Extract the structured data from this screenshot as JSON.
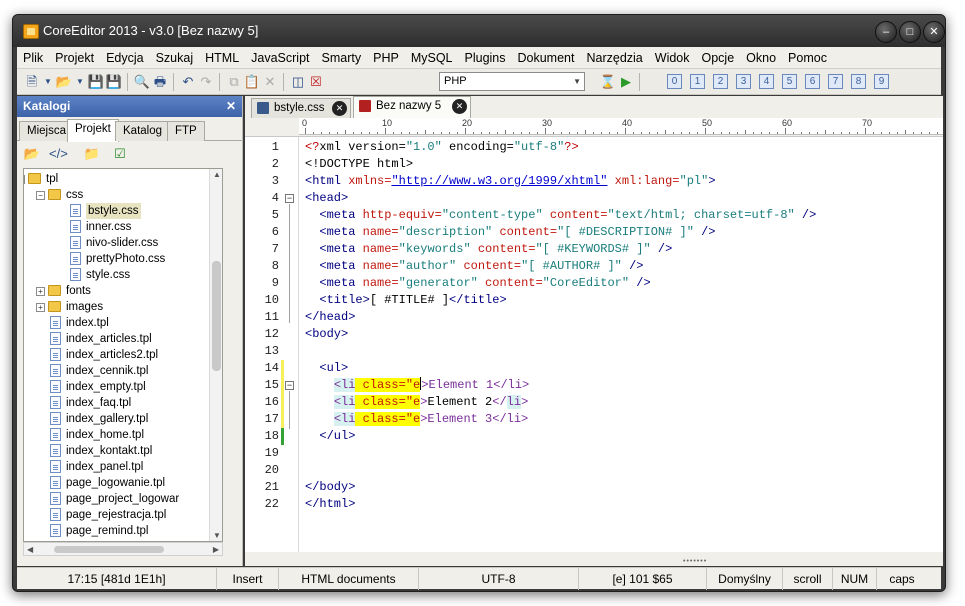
{
  "window": {
    "title": "CoreEditor 2013 - v3.0 [Bez nazwy 5]"
  },
  "menu": [
    "Plik",
    "Projekt",
    "Edycja",
    "Szukaj",
    "HTML",
    "JavaScript",
    "Smarty",
    "PHP",
    "MySQL",
    "Plugins",
    "Dokument",
    "Narzędzia",
    "Widok",
    "Opcje",
    "Okno",
    "Pomoc"
  ],
  "toolbar": {
    "language": "PHP",
    "bookmarks": [
      "0",
      "1",
      "2",
      "3",
      "4",
      "5",
      "6",
      "7",
      "8",
      "9"
    ]
  },
  "sidebar": {
    "title": "Katalogi",
    "tabs": [
      "Miejsca",
      "Projekt",
      "Katalog",
      "FTP"
    ],
    "active_tab": "Projekt",
    "tree": [
      {
        "label": "tpl",
        "type": "folder",
        "level": 0,
        "expanded": true
      },
      {
        "label": "css",
        "type": "folder",
        "level": 1,
        "expanded": true
      },
      {
        "label": "bstyle.css",
        "type": "file",
        "level": 2,
        "selected": true
      },
      {
        "label": "inner.css",
        "type": "file",
        "level": 2
      },
      {
        "label": "nivo-slider.css",
        "type": "file",
        "level": 2
      },
      {
        "label": "prettyPhoto.css",
        "type": "file",
        "level": 2
      },
      {
        "label": "style.css",
        "type": "file",
        "level": 2
      },
      {
        "label": "fonts",
        "type": "folder",
        "level": 1,
        "expanded": false
      },
      {
        "label": "images",
        "type": "folder",
        "level": 1,
        "expanded": false
      },
      {
        "label": "index.tpl",
        "type": "file",
        "level": 1
      },
      {
        "label": "index_articles.tpl",
        "type": "file",
        "level": 1
      },
      {
        "label": "index_articles2.tpl",
        "type": "file",
        "level": 1
      },
      {
        "label": "index_cennik.tpl",
        "type": "file",
        "level": 1
      },
      {
        "label": "index_empty.tpl",
        "type": "file",
        "level": 1
      },
      {
        "label": "index_faq.tpl",
        "type": "file",
        "level": 1
      },
      {
        "label": "index_gallery.tpl",
        "type": "file",
        "level": 1
      },
      {
        "label": "index_home.tpl",
        "type": "file",
        "level": 1
      },
      {
        "label": "index_kontakt.tpl",
        "type": "file",
        "level": 1
      },
      {
        "label": "index_panel.tpl",
        "type": "file",
        "level": 1
      },
      {
        "label": "page_logowanie.tpl",
        "type": "file",
        "level": 1
      },
      {
        "label": "page_project_logowar",
        "type": "file",
        "level": 1
      },
      {
        "label": "page_rejestracja.tpl",
        "type": "file",
        "level": 1
      },
      {
        "label": "page_remind.tpl",
        "type": "file",
        "level": 1
      }
    ]
  },
  "editor": {
    "tabs": [
      {
        "label": "bstyle.css",
        "active": false
      },
      {
        "label": "Bez nazwy 5",
        "active": true
      }
    ],
    "ruler": [
      "0",
      "10",
      "20",
      "30",
      "40",
      "50",
      "60",
      "70"
    ],
    "line_numbers": [
      "1",
      "2",
      "3",
      "4",
      "5",
      "6",
      "7",
      "8",
      "9",
      "10",
      "11",
      "12",
      "13",
      "14",
      "15",
      "16",
      "17",
      "18",
      "19",
      "20",
      "21",
      "22"
    ],
    "lines": [
      [
        [
          "p",
          "<?"
        ],
        [
          "k",
          "xml version="
        ],
        [
          "s",
          "\"1.0\""
        ],
        [
          "k",
          " encoding="
        ],
        [
          "s",
          "\"utf-8\""
        ],
        [
          "p",
          "?>"
        ]
      ],
      [
        [
          "k",
          "<!DOCTYPE html>"
        ]
      ],
      [
        [
          "t",
          "<html "
        ],
        [
          "a",
          "xmlns="
        ],
        [
          "u",
          "\"http://www.w3.org/1999/xhtml\""
        ],
        [
          "a",
          " xml:lang="
        ],
        [
          "s",
          "\"pl\""
        ],
        [
          "t",
          ">"
        ]
      ],
      [
        [
          "t",
          "<head>"
        ]
      ],
      [
        [
          "k",
          "  "
        ],
        [
          "t",
          "<meta "
        ],
        [
          "a",
          "http-equiv="
        ],
        [
          "s",
          "\"content-type\""
        ],
        [
          "a",
          " content="
        ],
        [
          "s",
          "\"text/html; charset=utf-8\""
        ],
        [
          "t",
          " />"
        ]
      ],
      [
        [
          "k",
          "  "
        ],
        [
          "t",
          "<meta "
        ],
        [
          "a",
          "name="
        ],
        [
          "s",
          "\"description\""
        ],
        [
          "a",
          " content="
        ],
        [
          "s",
          "\"[ #DESCRIPTION# ]\""
        ],
        [
          "t",
          " />"
        ]
      ],
      [
        [
          "k",
          "  "
        ],
        [
          "t",
          "<meta "
        ],
        [
          "a",
          "name="
        ],
        [
          "s",
          "\"keywords\""
        ],
        [
          "a",
          " content="
        ],
        [
          "s",
          "\"[ #KEYWORDS# ]\""
        ],
        [
          "t",
          " />"
        ]
      ],
      [
        [
          "k",
          "  "
        ],
        [
          "t",
          "<meta "
        ],
        [
          "a",
          "name="
        ],
        [
          "s",
          "\"author\""
        ],
        [
          "a",
          " content="
        ],
        [
          "s",
          "\"[ #AUTHOR# ]\""
        ],
        [
          "t",
          " />"
        ]
      ],
      [
        [
          "k",
          "  "
        ],
        [
          "t",
          "<meta "
        ],
        [
          "a",
          "name="
        ],
        [
          "s",
          "\"generator\""
        ],
        [
          "a",
          " content="
        ],
        [
          "s",
          "\"CoreEditor\""
        ],
        [
          "t",
          " />"
        ]
      ],
      [
        [
          "k",
          "  "
        ],
        [
          "t",
          "<title>"
        ],
        [
          "k",
          "[ #TITLE# ]"
        ],
        [
          "t",
          "</title>"
        ]
      ],
      [
        [
          "t",
          "</head>"
        ]
      ],
      [
        [
          "t",
          "<body>"
        ]
      ],
      [],
      [
        [
          "k",
          "  "
        ],
        [
          "t",
          "<ul>"
        ]
      ],
      [
        [
          "k",
          "    "
        ],
        [
          "hl2",
          "<li"
        ],
        [
          "hla",
          " class=\"e"
        ],
        [
          "caret",
          ""
        ],
        [
          "x",
          ">"
        ],
        [
          "x",
          "Element 1</li>"
        ]
      ],
      [
        [
          "k",
          "    "
        ],
        [
          "hl2",
          "<li"
        ],
        [
          "hla",
          " class=\"e"
        ],
        [
          "x",
          ">"
        ],
        [
          "k",
          "Element 2"
        ],
        [
          "x",
          "</"
        ],
        [
          "hl2",
          "li"
        ],
        [
          "x",
          ">"
        ]
      ],
      [
        [
          "k",
          "    "
        ],
        [
          "hl2",
          "<li"
        ],
        [
          "hla",
          " class=\"e"
        ],
        [
          "x",
          ">Element 3</li>"
        ]
      ],
      [
        [
          "k",
          "  "
        ],
        [
          "t",
          "</ul>"
        ]
      ],
      [],
      [],
      [
        [
          "t",
          "</body>"
        ]
      ],
      [
        [
          "t",
          "</html>"
        ]
      ]
    ]
  },
  "status": {
    "position": "17:15 [481d 1E1h]",
    "mode": "Insert",
    "doc_type": "HTML documents",
    "encoding": "UTF-8",
    "char": "[e] 101 $65",
    "profile": "Domyślny",
    "scroll": "scroll",
    "num": "NUM",
    "caps": "caps"
  }
}
